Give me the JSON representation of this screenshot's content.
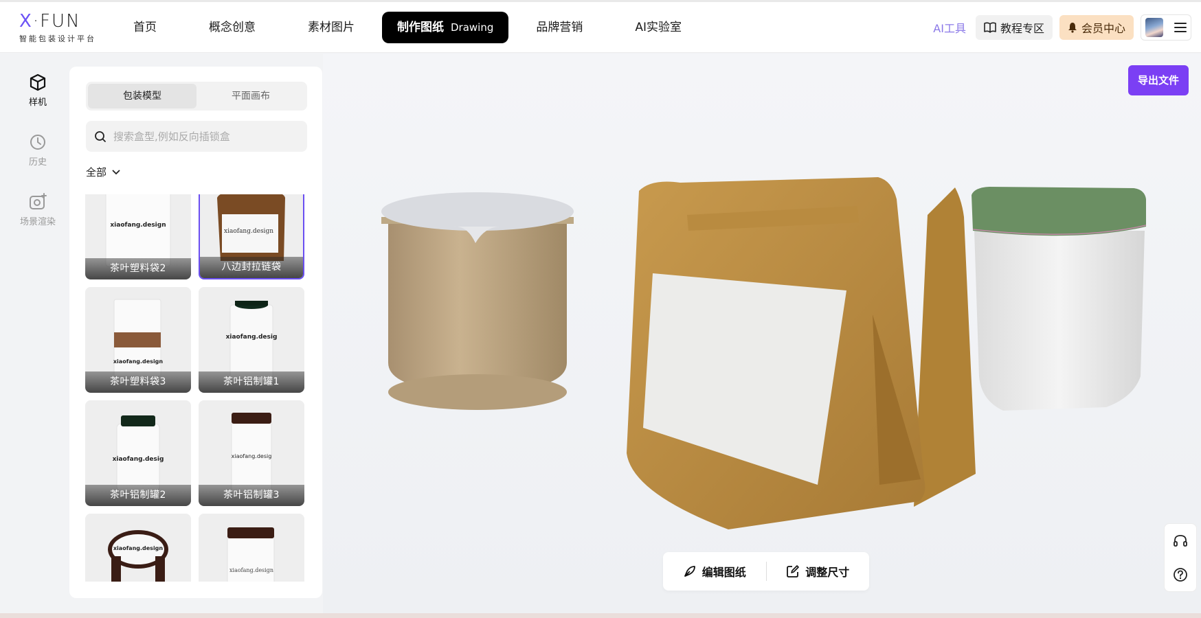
{
  "logo": {
    "mark": "X·FUN",
    "subtitle": "智能包装设计平台"
  },
  "nav": {
    "items": [
      "首页",
      "概念创意",
      "素材图片"
    ],
    "active_label": "制作图纸",
    "active_sub": "Drawing",
    "items_after": [
      "品牌营销",
      "AI实验室"
    ]
  },
  "right_tools": {
    "ai_tools": "AI工具",
    "tutorial": "教程专区",
    "vip": "会员中心"
  },
  "rail": [
    {
      "label": "样机",
      "icon": "cube-icon",
      "active": true
    },
    {
      "label": "历史",
      "icon": "history-icon",
      "active": false
    },
    {
      "label": "场景渲染",
      "icon": "camera-icon",
      "active": false
    }
  ],
  "panel": {
    "tabs": [
      "包装模型",
      "平面画布"
    ],
    "active_tab": "包装模型",
    "search_placeholder": "搜索盒型,例如反向插锁盒",
    "filter": "全部",
    "cards": [
      {
        "label": "茶叶塑料袋2",
        "thumb_text": "xiaofang.design",
        "selected": false
      },
      {
        "label": "八边封拉链袋",
        "thumb_text": "xiaofang.design",
        "selected": true
      },
      {
        "label": "茶叶塑料袋3",
        "thumb_text": "xiaofang.design",
        "selected": false
      },
      {
        "label": "茶叶铝制罐1",
        "thumb_text": "xiaofang.desig",
        "selected": false
      },
      {
        "label": "茶叶铝制罐2",
        "thumb_text": "xiaofang.desig",
        "selected": false
      },
      {
        "label": "茶叶铝制罐3",
        "thumb_text": "xiaofang.desig",
        "selected": false
      },
      {
        "label": "",
        "thumb_text": "xiaofang.design",
        "selected": false
      },
      {
        "label": "",
        "thumb_text": "xiaofang.design",
        "selected": false
      }
    ]
  },
  "canvas": {
    "export_button": "导出文件",
    "edit_drawing": "编辑图纸",
    "resize": "调整尺寸"
  }
}
